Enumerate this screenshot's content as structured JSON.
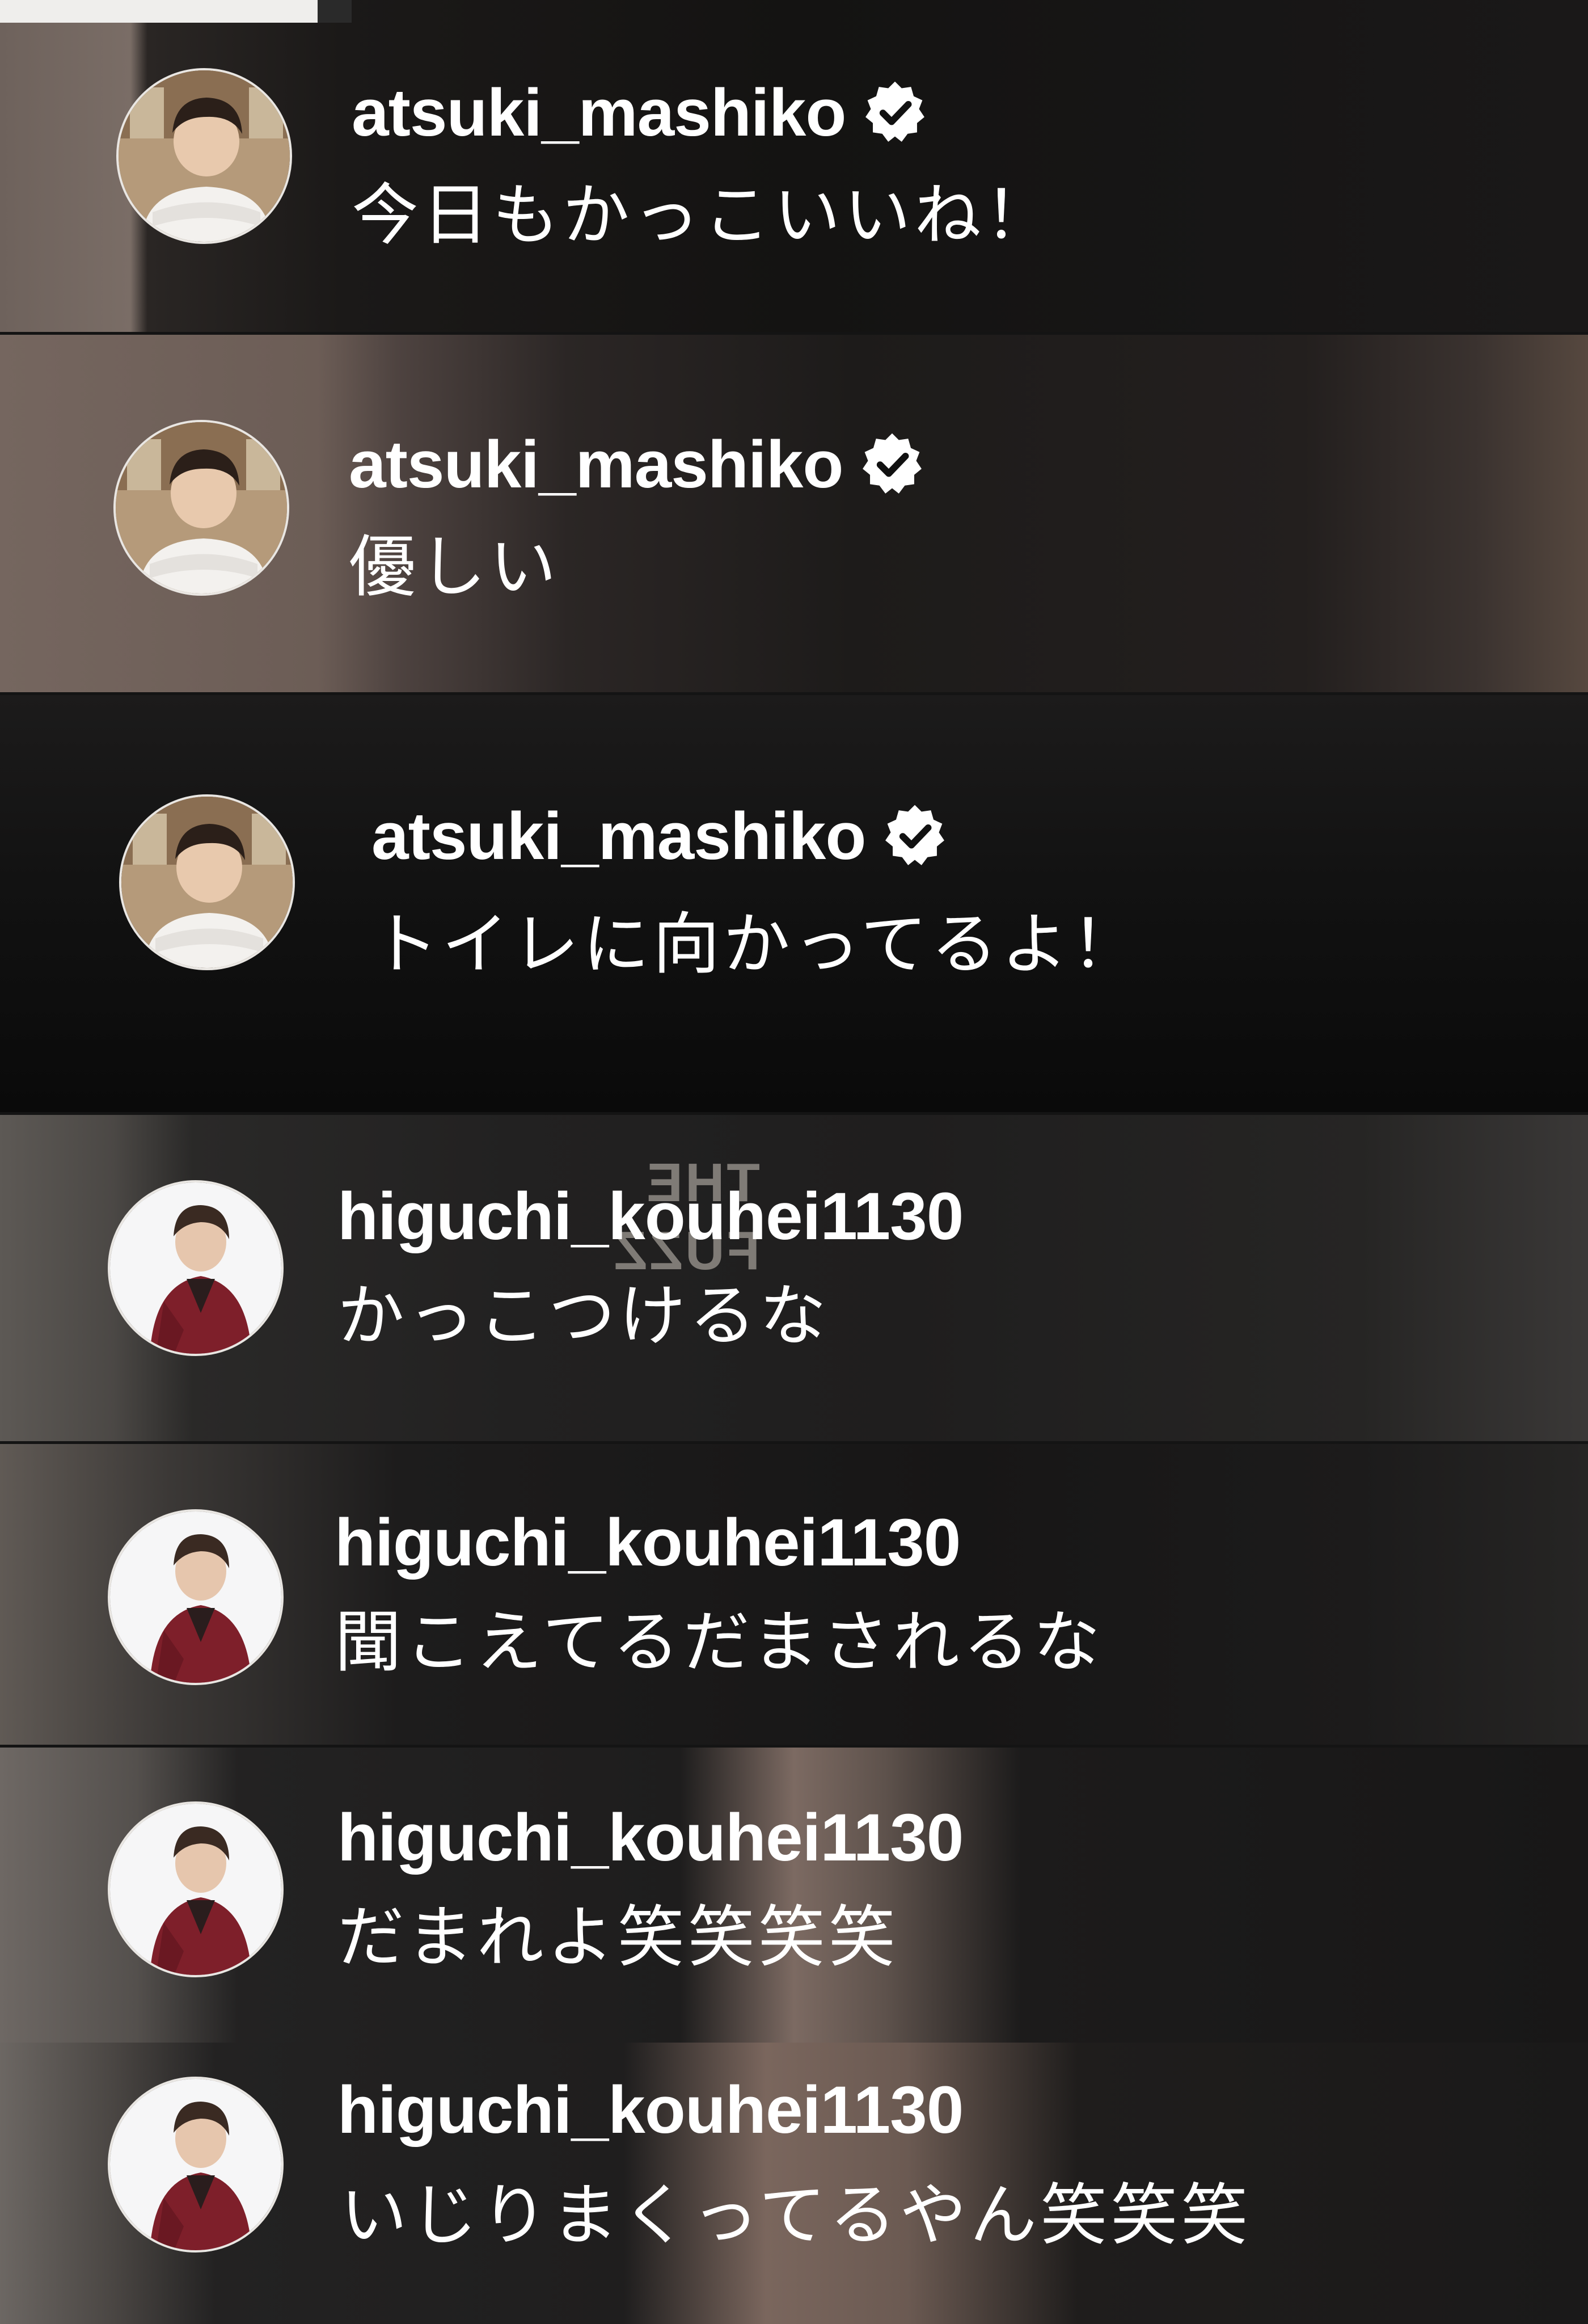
{
  "comments": [
    {
      "username": "atsuki_mashiko",
      "verified": true,
      "text": "今日もかっこいいね！",
      "avatar": "atsuki-avatar"
    },
    {
      "username": "atsuki_mashiko",
      "verified": true,
      "text": "優しい",
      "avatar": "atsuki-avatar"
    },
    {
      "username": "atsuki_mashiko",
      "verified": true,
      "text": "トイレに向かってるよ！",
      "avatar": "atsuki-avatar"
    },
    {
      "username": "higuchi_kouhei1130",
      "verified": false,
      "text": "かっこつけるな",
      "avatar": "higuchi-avatar"
    },
    {
      "username": "higuchi_kouhei1130",
      "verified": false,
      "text": "聞こえてるだまされるな",
      "avatar": "higuchi-avatar"
    },
    {
      "username": "higuchi_kouhei1130",
      "verified": false,
      "text": "だまれよ笑笑笑笑",
      "avatar": "higuchi-avatar"
    },
    {
      "username": "higuchi_kouhei1130",
      "verified": false,
      "text": "いじりまくってるやん笑笑笑",
      "avatar": "higuchi-avatar"
    }
  ],
  "background_print": "THE FUZZ",
  "colors": {
    "text": "#ffffff",
    "verified_badge": "#ffffff",
    "verified_check": "#111111"
  }
}
